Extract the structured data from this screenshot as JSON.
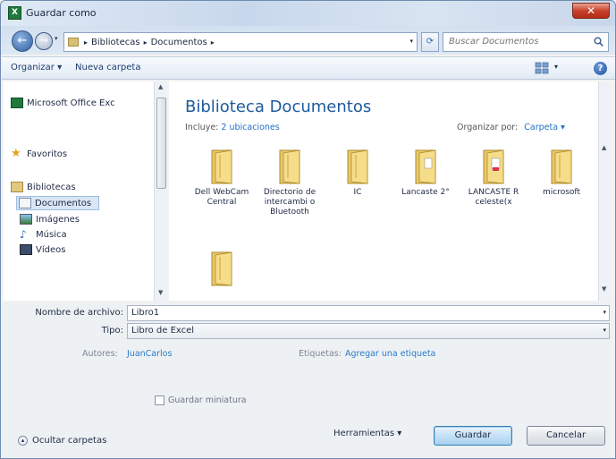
{
  "window": {
    "title": "Guardar como",
    "app_icon": "excel-icon"
  },
  "nav": {
    "breadcrumbs": [
      "Bibliotecas",
      "Documentos"
    ],
    "search_placeholder": "Buscar Documentos"
  },
  "toolbar": {
    "organize": "Organizar ▾",
    "new_folder": "Nueva carpeta"
  },
  "sidebar": {
    "items": [
      {
        "label": "Microsoft Office Exc",
        "icon": "excel-icon"
      },
      {
        "label": "Favoritos",
        "icon": "star-icon"
      },
      {
        "label": "Bibliotecas",
        "icon": "libraries-icon"
      },
      {
        "label": "Documentos",
        "icon": "documents-icon"
      },
      {
        "label": "Imágenes",
        "icon": "pictures-icon"
      },
      {
        "label": "Música",
        "icon": "music-icon"
      },
      {
        "label": "Vídeos",
        "icon": "videos-icon"
      }
    ]
  },
  "library": {
    "title": "Biblioteca Documentos",
    "includes_label": "Incluye:",
    "includes_link": "2 ubicaciones",
    "arrange_label": "Organizar por:",
    "arrange_value": "Carpeta ▾"
  },
  "folders": [
    {
      "name": "Dell WebCam Central"
    },
    {
      "name": "Directorio de intercambi o Bluetooth"
    },
    {
      "name": "IC"
    },
    {
      "name": "Lancaste 2°"
    },
    {
      "name": "LANCASTE R celeste(x"
    },
    {
      "name": "microsoft"
    },
    {
      "name": ""
    }
  ],
  "form": {
    "filename_label": "Nombre de archivo:",
    "filename_value": "Libro1",
    "type_label": "Tipo:",
    "type_value": "Libro de Excel",
    "authors_label": "Autores:",
    "authors_value": "JuanCarlos",
    "tags_label": "Etiquetas:",
    "tags_value": "Agregar una etiqueta",
    "thumbnail_label": "Guardar miniatura"
  },
  "footer": {
    "hide_folders": "Ocultar carpetas",
    "tools": "Herramientas ▾",
    "save": "Guardar",
    "cancel": "Cancelar"
  }
}
